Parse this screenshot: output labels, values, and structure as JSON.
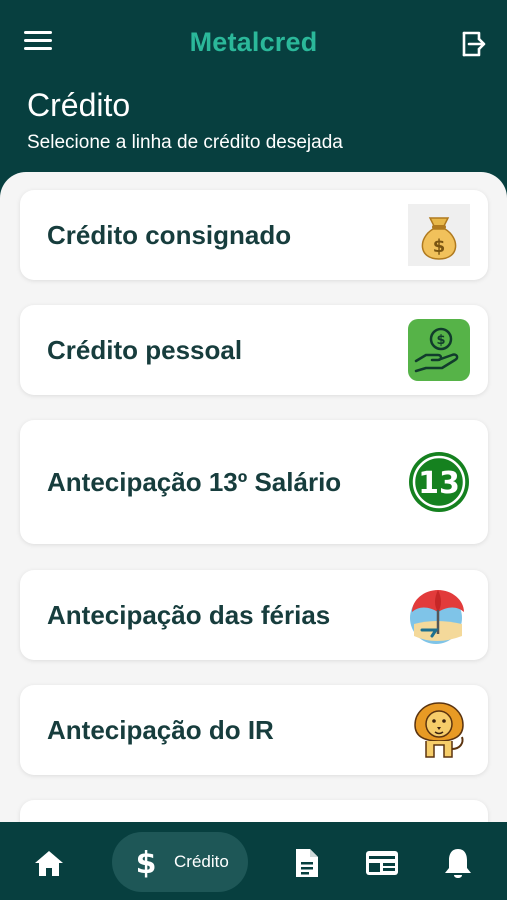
{
  "app": {
    "brand": "Metalcred"
  },
  "header": {
    "title": "Crédito",
    "subtitle": "Selecione a linha de crédito desejada"
  },
  "credit_lines": [
    {
      "label": "Crédito consignado",
      "icon": "money-bag-icon"
    },
    {
      "label": "Crédito pessoal",
      "icon": "hand-money-icon"
    },
    {
      "label": "Antecipação 13º Salário",
      "icon": "number-13-icon"
    },
    {
      "label": "Antecipação das férias",
      "icon": "beach-umbrella-icon"
    },
    {
      "label": "Antecipação do IR",
      "icon": "lion-icon"
    }
  ],
  "bottom_nav": {
    "items": [
      {
        "name": "home",
        "icon": "home-icon"
      },
      {
        "name": "credito",
        "icon": "dollar-icon",
        "label": "Crédito",
        "active": true
      },
      {
        "name": "documents",
        "icon": "document-icon"
      },
      {
        "name": "card",
        "icon": "card-icon"
      },
      {
        "name": "notifications",
        "icon": "bell-icon"
      }
    ]
  },
  "colors": {
    "primary_dark": "#073f3f",
    "brand_green": "#2bb89a",
    "card_text": "#173d3d",
    "active_nav_pill": "#1e5757"
  }
}
